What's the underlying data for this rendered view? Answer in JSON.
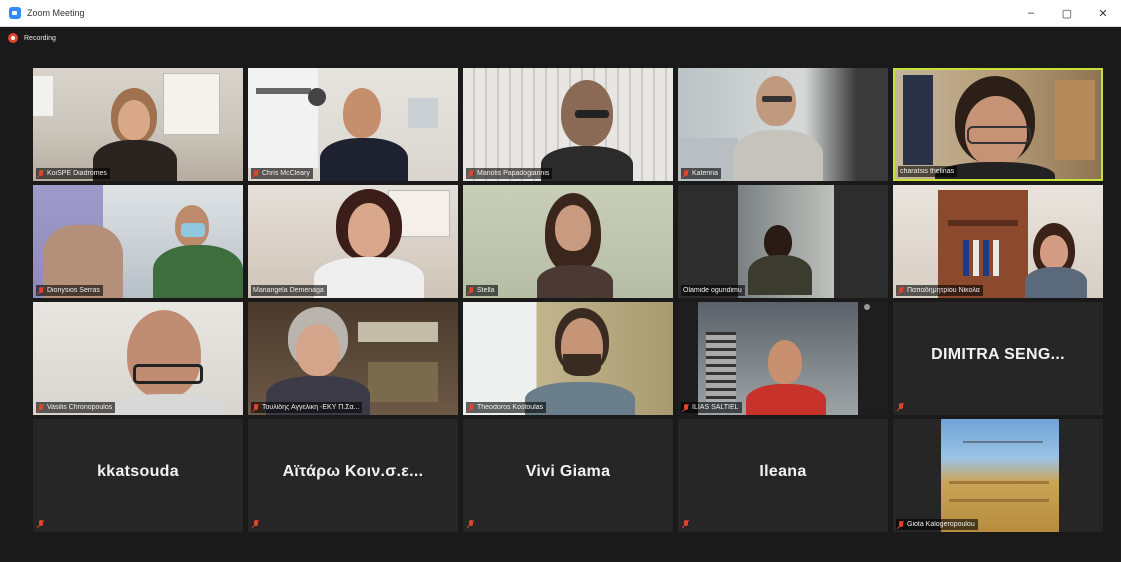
{
  "window": {
    "title": "Zoom Meeting",
    "controls": {
      "minimize": "–",
      "maximize": "▢",
      "close": "✕"
    }
  },
  "recording": {
    "label": "Recording"
  },
  "colors": {
    "active_speaker_border": "#c7e33a",
    "muted_mic": "#e0442b",
    "background": "#1a1a1a",
    "tile": "#262626"
  },
  "participants": [
    {
      "name": "KoiSPE Diadromes",
      "video": true,
      "muted": true
    },
    {
      "name": "Chris McCleary",
      "video": true,
      "muted": true
    },
    {
      "name": "Manolis Papadogiannis",
      "video": true,
      "muted": true
    },
    {
      "name": "Katerina",
      "video": true,
      "muted": true
    },
    {
      "name": "charatsis thelinas",
      "video": true,
      "muted": false,
      "active": true
    },
    {
      "name": "Dionysios Serras",
      "video": true,
      "muted": true
    },
    {
      "name": "Mariangela Demenaga",
      "video": true,
      "muted": false
    },
    {
      "name": "Stella",
      "video": true,
      "muted": true
    },
    {
      "name": "Olamide ogundimu",
      "video": true,
      "muted": false
    },
    {
      "name": "Παπαδημητρίου Νίκολα",
      "video": true,
      "muted": true
    },
    {
      "name": "Vasilis Chronopoulos",
      "video": true,
      "muted": true
    },
    {
      "name": "Τουλίδης Αγγελική -ΕΚΥ Π.Σα...",
      "video": true,
      "muted": true
    },
    {
      "name": "Theodoros Kostoulas",
      "video": true,
      "muted": true
    },
    {
      "name": "ILIAS SALTIEL",
      "video": true,
      "muted": true
    },
    {
      "name": "DIMITRA SENG...",
      "video": false,
      "muted": true
    },
    {
      "name": "kkatsouda",
      "video": false,
      "muted": true
    },
    {
      "name": "Αϊτάρω Κοιν.σ.ε...",
      "video": false,
      "muted": true
    },
    {
      "name": "Vivi Giama",
      "video": false,
      "muted": true
    },
    {
      "name": "Ileana",
      "video": false,
      "muted": true
    },
    {
      "name": "Giota Kalogeropoulou",
      "video": true,
      "muted": true
    }
  ]
}
